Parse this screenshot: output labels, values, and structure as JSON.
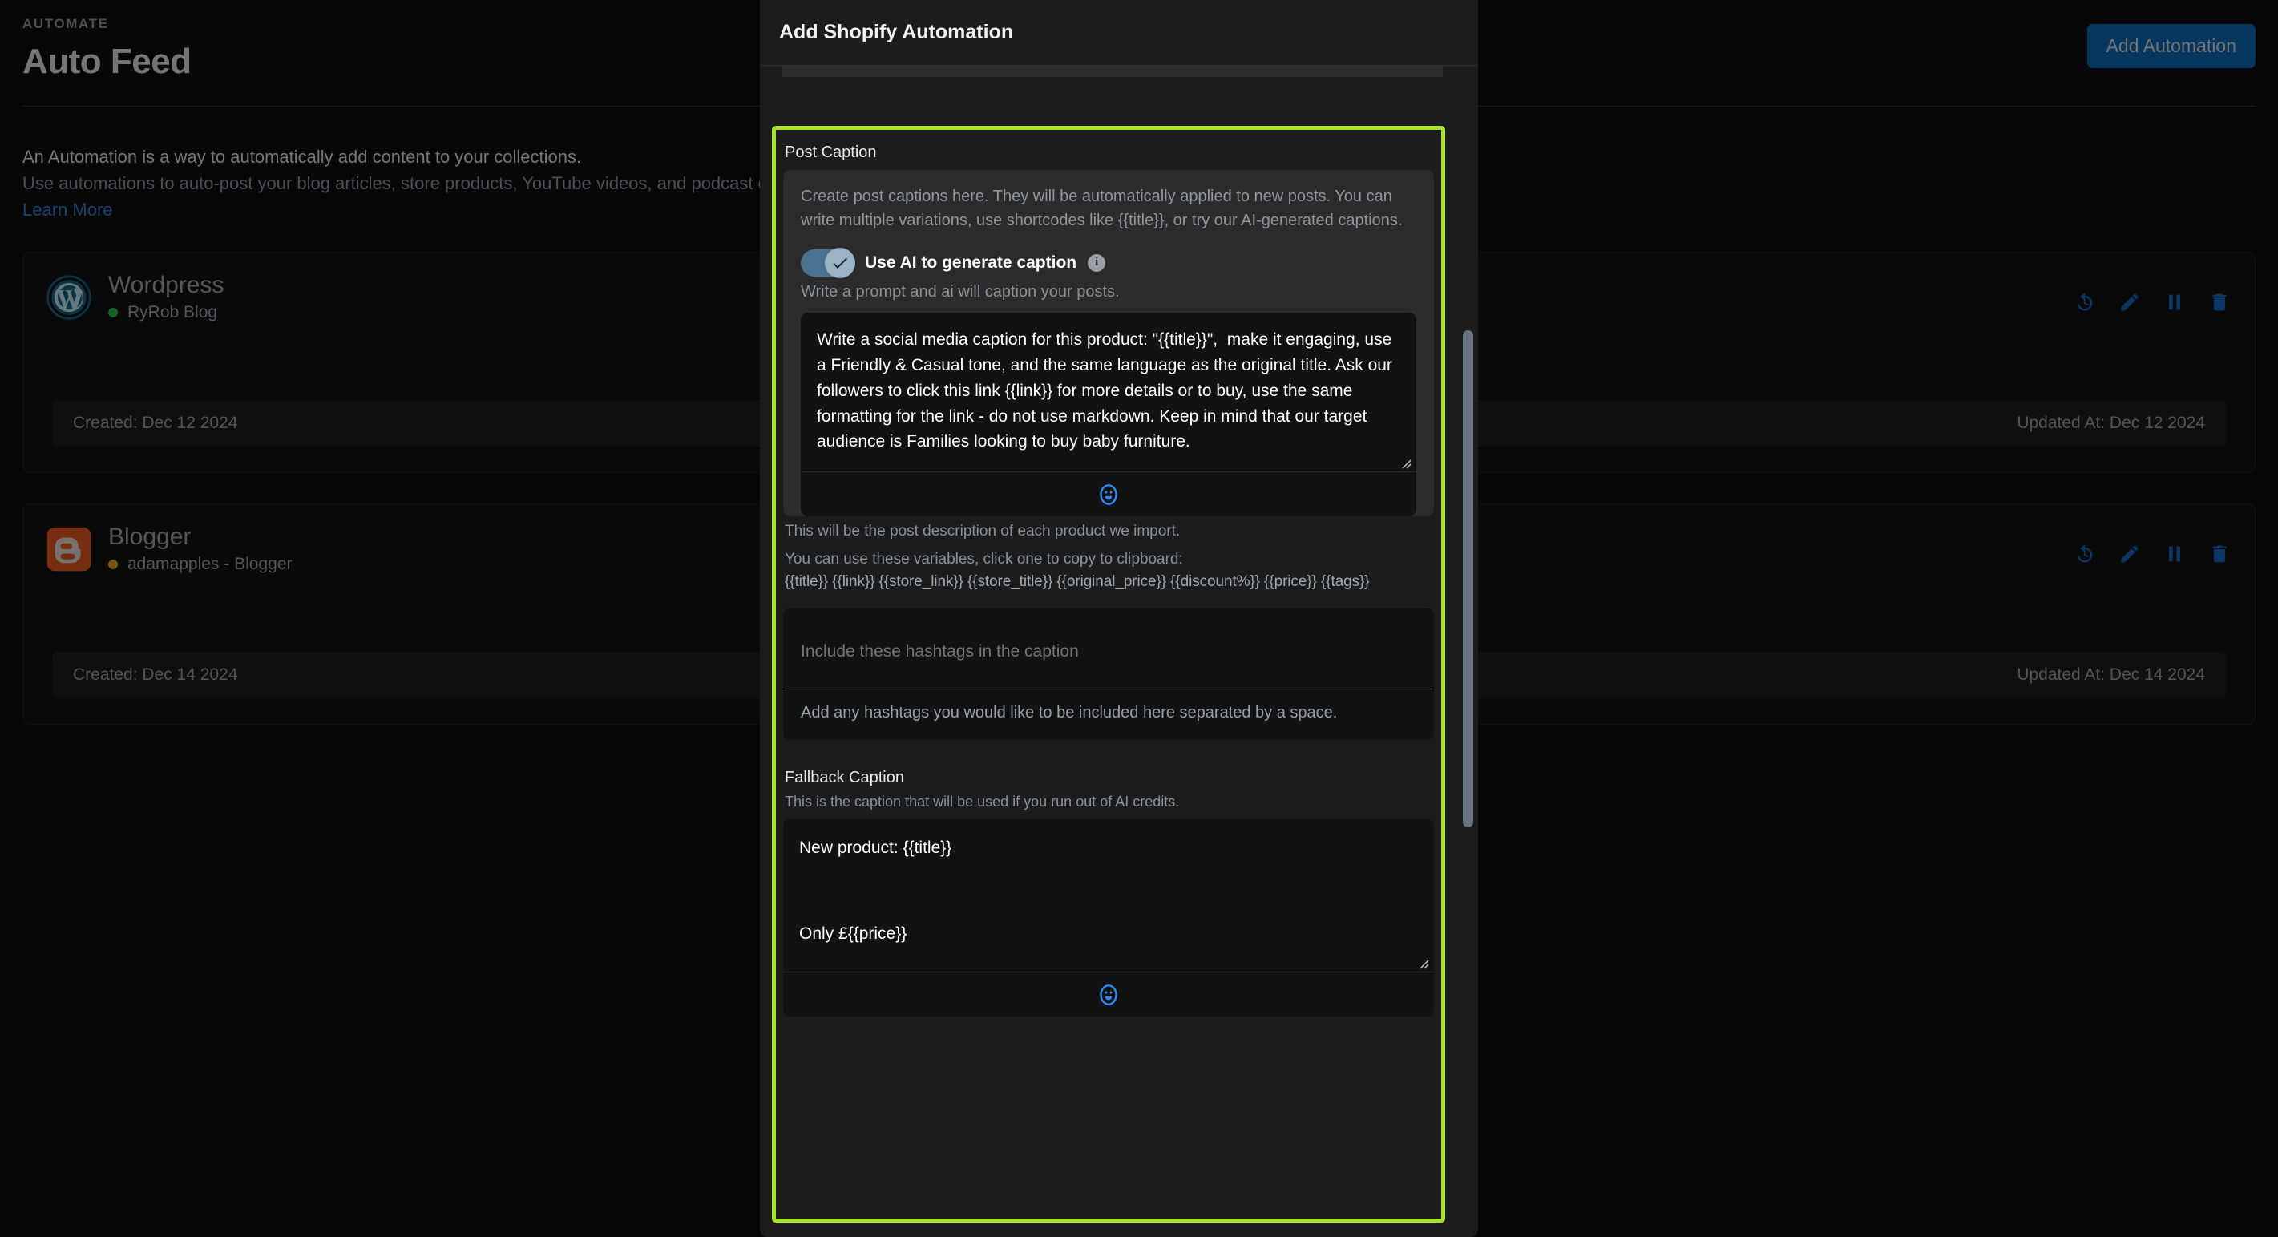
{
  "page": {
    "eyebrow": "AUTOMATE",
    "title": "Auto Feed",
    "intro_line1": "An Automation is a way to automatically add content to your collections.",
    "intro_line2": "Use automations to auto-post your blog articles, store products, YouTube videos, and podcast episodes.",
    "learn_more": "Learn More",
    "add_automation_label": "Add Automation",
    "accent_blue": "#0d63ab"
  },
  "automations": [
    {
      "name": "Wordpress",
      "account": "RyRob Blog",
      "status_color": "#2bb24c",
      "created": "Created: Dec 12 2024",
      "updated": "Updated At: Dec 12 2024"
    },
    {
      "name": "Blogger",
      "account": "adamapples - Blogger",
      "status_color": "#d99a16",
      "created": "Created: Dec 14 2024",
      "updated": "Updated At: Dec 14 2024"
    }
  ],
  "card_actions": [
    {
      "name": "history-icon"
    },
    {
      "name": "edit-icon"
    },
    {
      "name": "pause-icon"
    },
    {
      "name": "delete-icon"
    }
  ],
  "modal": {
    "title": "Add Shopify Automation",
    "highlight_color": "#a6e227",
    "post_caption": {
      "label": "Post Caption",
      "description": "Create post captions here. They will be automatically applied to new posts. You can write multiple variations, use shortcodes like {{title}}, or try our AI-generated captions.",
      "toggle_label": "Use AI to generate caption",
      "toggle_on": true,
      "toggle_help": "Write a prompt and ai will caption your posts.",
      "prompt_value": "Write a social media caption for this product: \"{{title}}\",  make it engaging, use a Friendly & Casual tone, and the same language as the original title. Ask our followers to click this link {{link}} for more details or to buy, use the same formatting for the link - do not use markdown. Keep in mind that our target audience is Families looking to buy baby furniture.",
      "hint_1": "This will be the post description of each product we import.",
      "hint_2": "You can use these variables, click one to copy to clipboard:",
      "variables": "{{title}} {{link}} {{store_link}} {{store_title}} {{original_price}} {{discount%}} {{price}} {{tags}}",
      "hashtags_placeholder": "Include these hashtags in the caption",
      "hashtags_value": "",
      "hashtags_help": "Add any hashtags you would like to be included here separated by a space."
    },
    "fallback_caption": {
      "label": "Fallback Caption",
      "help": "This is the caption that will be used if you run out of AI credits.",
      "value": "New product: {{title}}\n\nOnly £{{price}}\n\n👉👉 {{link}}\n\n{{tags}}"
    },
    "emoji_button_name": "emoji-picker-icon"
  }
}
